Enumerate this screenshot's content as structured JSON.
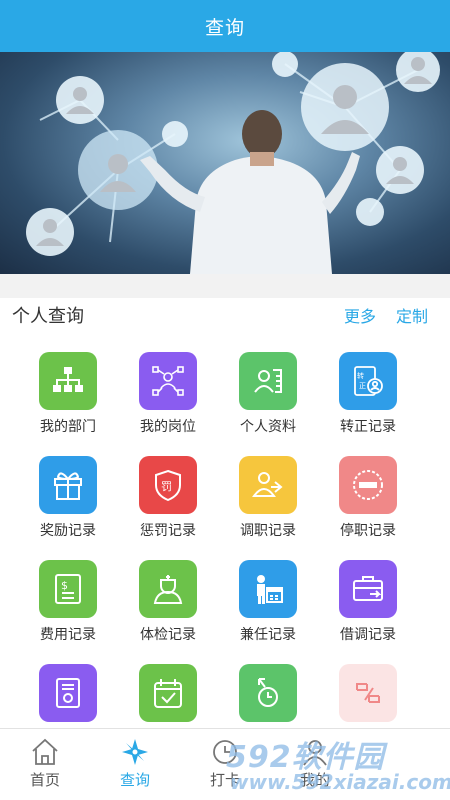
{
  "header": {
    "title": "查询"
  },
  "banner": {
    "image": "business-man-touching-network-of-user-icons"
  },
  "section": {
    "title": "个人查询",
    "more_label": "更多",
    "custom_label": "定制"
  },
  "grid": [
    {
      "label": "我的部门",
      "icon": "org-chart-icon",
      "color": "#6cc24a"
    },
    {
      "label": "我的岗位",
      "icon": "position-network-icon",
      "color": "#8a5cf0"
    },
    {
      "label": "个人资料",
      "icon": "profile-card-icon",
      "color": "#5cc46a"
    },
    {
      "label": "转正记录",
      "icon": "regularization-doc-icon",
      "color": "#2f9de8"
    },
    {
      "label": "奖励记录",
      "icon": "gift-icon",
      "color": "#2f9de8"
    },
    {
      "label": "惩罚记录",
      "icon": "penalty-shield-icon",
      "color": "#e84848"
    },
    {
      "label": "调职记录",
      "icon": "transfer-users-icon",
      "color": "#f6c63d"
    },
    {
      "label": "停职记录",
      "icon": "suspend-icon",
      "color": "#f08888"
    },
    {
      "label": "费用记录",
      "icon": "expense-doc-icon",
      "color": "#6cc24a"
    },
    {
      "label": "体检记录",
      "icon": "doctor-icon",
      "color": "#6cc24a"
    },
    {
      "label": "兼任记录",
      "icon": "concurrent-post-icon",
      "color": "#2f9de8"
    },
    {
      "label": "借调记录",
      "icon": "briefcase-transfer-icon",
      "color": "#8a5cf0"
    },
    {
      "label": "",
      "icon": "certificate-icon",
      "color": "#8a5cf0"
    },
    {
      "label": "",
      "icon": "calendar-check-icon",
      "color": "#6cc24a"
    },
    {
      "label": "",
      "icon": "clock-arrow-icon",
      "color": "#5cc46a"
    },
    {
      "label": "",
      "icon": "exchange-icon",
      "color": "#f08888"
    }
  ],
  "tabbar": {
    "tabs": [
      {
        "label": "首页",
        "icon": "home-icon"
      },
      {
        "label": "查询",
        "icon": "compass-icon"
      },
      {
        "label": "打卡",
        "icon": "clock-in-icon"
      },
      {
        "label": "我的",
        "icon": "user-icon"
      }
    ]
  },
  "watermark": {
    "main": "592软件园",
    "sub": "www.592xiazai.com"
  },
  "colors": {
    "primary": "#2aa8e6"
  }
}
